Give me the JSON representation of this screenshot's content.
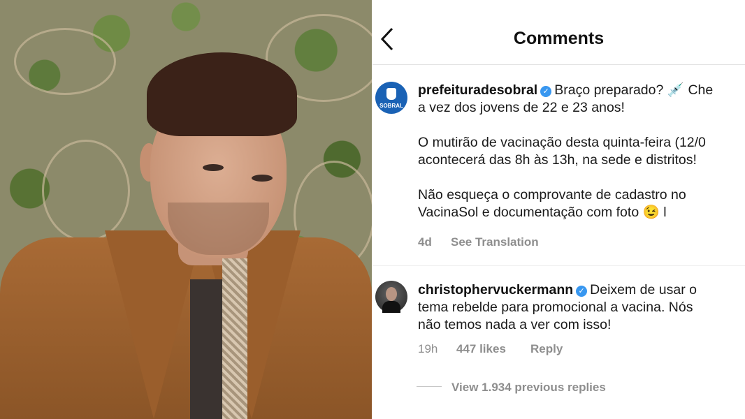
{
  "header": {
    "title": "Comments",
    "back_icon": "chevron-left-icon"
  },
  "comments": [
    {
      "username": "prefeituradesobral",
      "avatar_text": "SOBRAL",
      "verified": true,
      "text_first": "Braço preparado? 💉 Che",
      "line2": "a vez dos jovens de 22 e 23 anos!",
      "line3": "O mutirão de vacinação desta quinta-feira (12/0",
      "line4": "acontecerá das 8h às 13h, na sede e distritos!",
      "line5": "Não esqueça o comprovante de cadastro no",
      "line6": "VacinaSol e documentação com foto 😉 l",
      "time": "4d",
      "see_translation": "See Translation"
    },
    {
      "username": "christophervuckermann",
      "verified": true,
      "text_first": "Deixem de usar o",
      "line2": "tema rebelde para promocional a vacina. Nós",
      "line3": "não temos nada a ver com isso!",
      "time": "19h",
      "likes": "447 likes",
      "reply": "Reply",
      "view_replies": "View 1.934 previous replies"
    }
  ],
  "colors": {
    "verified": "#3897f0",
    "meta": "#8e8e8e",
    "avatar_sobral": "#1a62b5"
  }
}
